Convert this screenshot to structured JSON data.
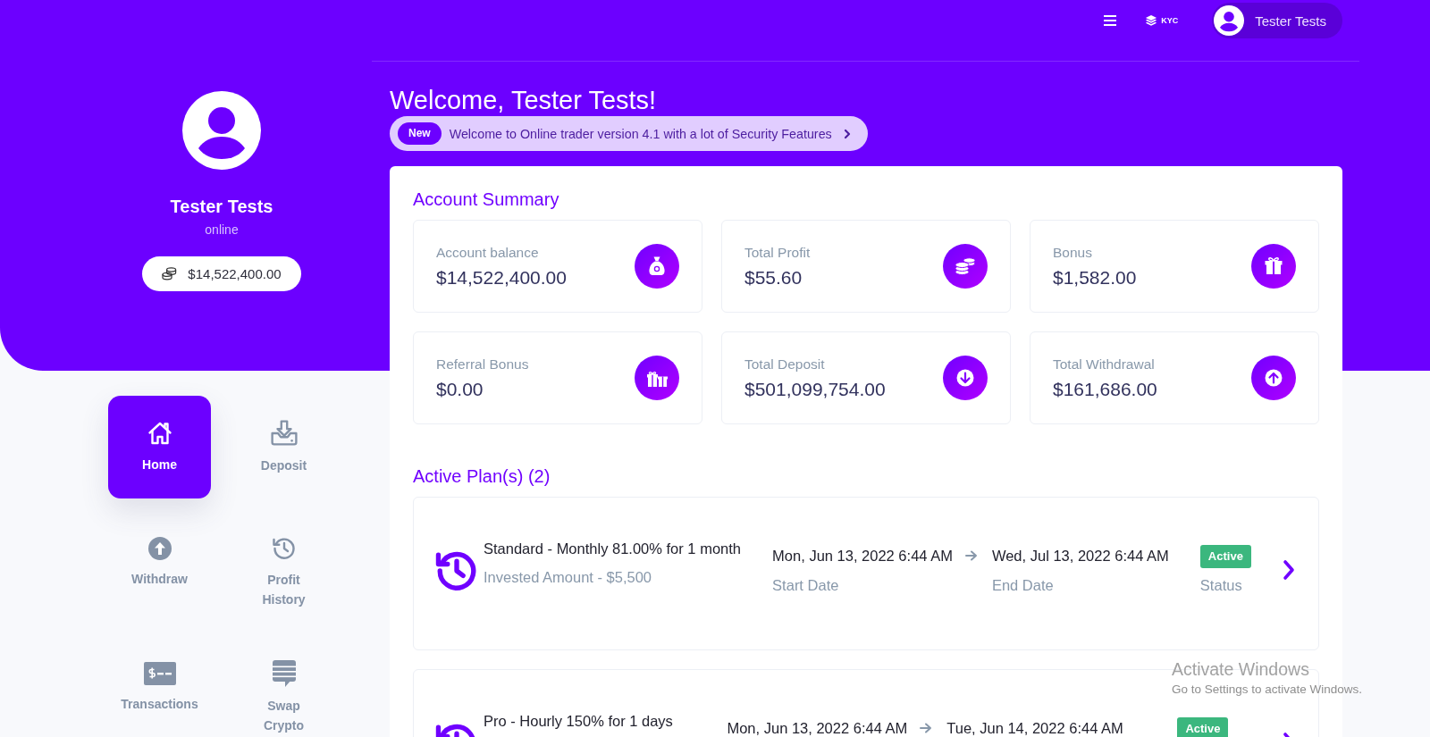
{
  "topbar": {
    "kyc_label": "KYC",
    "user_name": "Tester Tests"
  },
  "profile": {
    "name": "Tester Tests",
    "status": "online",
    "balance": "$14,522,400.00"
  },
  "nav": [
    {
      "label": "Home",
      "selected": true
    },
    {
      "label": "Deposit",
      "selected": false
    },
    {
      "label": "Withdraw",
      "selected": false
    },
    {
      "label": "Profit History",
      "selected": false
    },
    {
      "label": "Transactions",
      "selected": false
    },
    {
      "label": "Swap Crypto",
      "selected": false
    }
  ],
  "welcome": {
    "title": "Welcome, Tester Tests!",
    "announcement": {
      "tag": "New",
      "text": "Welcome to Online trader version 4.1 with a lot of Security Features"
    }
  },
  "account_summary": {
    "title": "Account Summary",
    "stats": [
      {
        "label": "Account balance",
        "value": "$14,522,400.00"
      },
      {
        "label": "Total Profit",
        "value": "$55.60"
      },
      {
        "label": "Bonus",
        "value": "$1,582.00"
      },
      {
        "label": "Referral Bonus",
        "value": "$0.00"
      },
      {
        "label": "Total Deposit",
        "value": "$501,099,754.00"
      },
      {
        "label": "Total Withdrawal",
        "value": "$161,686.00"
      }
    ]
  },
  "active_plans": {
    "title": "Active Plan(s) (2)",
    "plans": [
      {
        "name": "Standard - Monthly 81.00% for 1 month",
        "invested": "Invested Amount - $5,500",
        "start_date": "Mon, Jun 13, 2022 6:44 AM",
        "start_label": "Start Date",
        "end_date": "Wed, Jul 13, 2022 6:44 AM",
        "end_label": "End Date",
        "status": "Active",
        "status_label": "Status"
      },
      {
        "name": "Pro - Hourly 150% for 1 days",
        "start_date": "Mon, Jun 13, 2022 6:44 AM",
        "end_date": "Tue, Jun 14, 2022 6:44 AM",
        "status": "Active"
      }
    ]
  },
  "os_notice": {
    "title": "Activate Windows",
    "text": "Go to Settings to activate Windows."
  }
}
